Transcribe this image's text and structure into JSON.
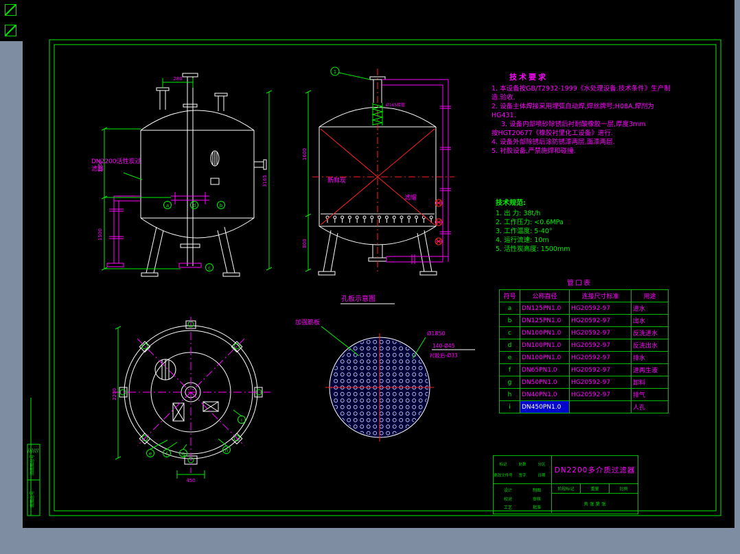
{
  "window": {
    "page_bg": "#7e8da1",
    "canvas_bg": "#000000",
    "frame_color": "#00ee00",
    "line_color": "#ffffff",
    "accent_magenta": "#ff00ff",
    "accent_red": "#ff2020",
    "highlight_blue": "#0000cc"
  },
  "icons": [
    {
      "name": "app-glyph-1"
    },
    {
      "name": "app-glyph-2"
    }
  ],
  "views": {
    "left_vessel": {
      "label_lines": [
        "DN2200活性炭过",
        "滤器"
      ],
      "dims": {
        "top": "280",
        "left_upper": "1650",
        "left_lower": "1500",
        "right": "3165"
      },
      "callouts": [
        "a",
        "d",
        "b",
        "c"
      ]
    },
    "center_vessel": {
      "fresh_carbon": "新鲜炭",
      "filter_cap": "滤帽",
      "top_nozzle_label": "Ø165接管",
      "balloon_no": "1",
      "dims": {
        "left_upper": "1600",
        "left_lower": "800"
      }
    },
    "plan_view": {
      "dims": {
        "bottom": "450",
        "left": "2200"
      },
      "callouts": [
        "e",
        "f",
        "g",
        "h",
        "i"
      ]
    },
    "plate_view": {
      "title": "孔板示意图",
      "rib_label": "加强筋板",
      "dim_diameter": "Ø1850",
      "dim_holes": "140-Ø45",
      "dim_lined": "衬胶后-Ø33"
    }
  },
  "tech_requirements": {
    "title": "技术要求",
    "lines": [
      "1. 本设备按GB/T2932-1999《水处理设备.技术条件》生产制造.验收.",
      "2. 设备主体焊接采用埋弧自动焊,焊丝牌号;H08A.焊剂为HG431.",
      "3. 设备内部喷砂除锈后衬耐酸橡胶一层,厚度3mm",
      "按HGT20677《橡胶衬里化工设备》进行.",
      "4. 设备外部除锈后涂防锈漆两层,面漆两层.",
      "5. 衬胶设备,严禁施焊和碰撞."
    ]
  },
  "tech_specs": {
    "title": "技术规范:",
    "lines": [
      "1. 出  力: 38t/h",
      "2. 工作压力: <0.6MPa",
      "3. 工作温度: 5-40°",
      "4. 运行流速: 10m",
      "5. 活性炭高度: 1500mm"
    ]
  },
  "nozzle_table": {
    "title": "管口表",
    "headers": [
      "符号",
      "公称直径",
      "连接尺寸标准",
      "用途"
    ],
    "rows": [
      [
        "a",
        "DN125PN1.0",
        "HG20592-97",
        "进水"
      ],
      [
        "b",
        "DN125PN1.0",
        "HG20592-97",
        "出水"
      ],
      [
        "c",
        "DN100PN1.0",
        "HG20592-97",
        "反洗进水"
      ],
      [
        "d",
        "DN100PN1.0",
        "HG20592-97",
        "反洗出水"
      ],
      [
        "e",
        "DN100PN1.0",
        "HG20592-97",
        "排水"
      ],
      [
        "f",
        "DN65PN1.0",
        "HG20592-97",
        "进再生液"
      ],
      [
        "g",
        "DN50PN1.0",
        "HG20592-97",
        "卸料"
      ],
      [
        "h",
        "DN40PN1.0",
        "HG20592-97",
        "排气"
      ],
      [
        "i",
        "DN450PN1.0",
        "",
        "人孔"
      ]
    ],
    "highlight": {
      "row": 8,
      "col": 1
    }
  },
  "title_block": {
    "main_title": "DN2200多介质过滤器",
    "revision_row": [
      "标记",
      "处数",
      "分区",
      "更改文件号",
      "签字",
      "日期"
    ],
    "left_labels": [
      "设计",
      "制图",
      "校对",
      "审核",
      "工艺",
      "批准"
    ],
    "stage_labels": [
      "阶段标记",
      "重量",
      "比例"
    ],
    "sheet_text": "共 张 第 张"
  },
  "side_strip": {
    "hatch": "//////",
    "labels": [
      "旧底图总号",
      "底图总号"
    ]
  }
}
